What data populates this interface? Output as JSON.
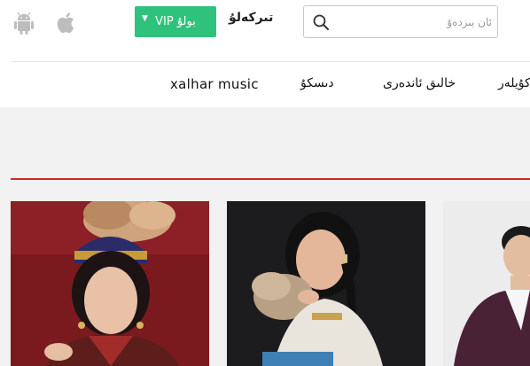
{
  "header": {
    "platform_icons": [
      "android-icon",
      "apple-icon"
    ],
    "vip_button": {
      "label": "VIP بولۇ",
      "caret": "▼",
      "color": "#2fc27c"
    },
    "register_label": "تىركەلۇ",
    "search": {
      "placeholder": "ئان بىزدەۇ",
      "value": ""
    }
  },
  "nav": {
    "items": [
      {
        "label": "xalhar music"
      },
      {
        "label": "دىسكۇ"
      },
      {
        "label": "خالىق ئاندەرى"
      },
      {
        "label": "كۇيلەر"
      }
    ]
  },
  "banner": {
    "background": "#f2f2f2",
    "accent": "#d0282a"
  },
  "cards": [
    {
      "image": "singer-portrait-traditional-headdress"
    },
    {
      "image": "singer-portrait-feather-fan"
    },
    {
      "image": "singer-portrait-suit"
    }
  ]
}
